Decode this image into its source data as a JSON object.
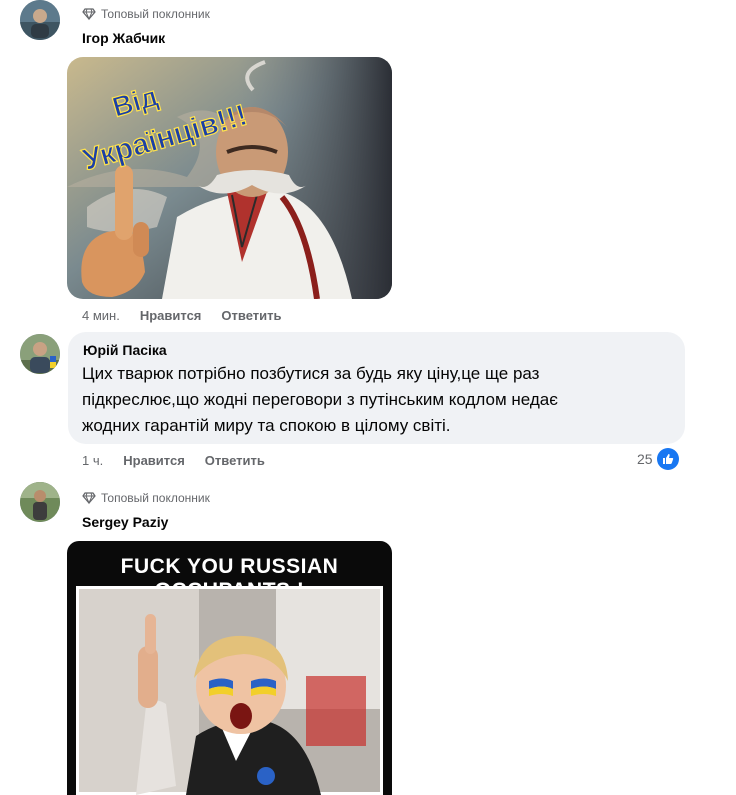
{
  "comments": [
    {
      "badge": "Топовый поклонник",
      "author": "Ігор Жабчик",
      "meme_text": "Від Українців!!!",
      "time": "4 мин.",
      "like_label": "Нравится",
      "reply_label": "Ответить"
    },
    {
      "author": "Юрій Пасіка",
      "text_lines": [
        "Цих тварюк потрібно позбутися за будь яку ціну,це ще раз",
        "підкреслює,що жодні переговори з путінським кодлом недає",
        "жодних гарантій миру та спокою в цілому світі."
      ],
      "time": "1 ч.",
      "like_label": "Нравится",
      "reply_label": "Ответить",
      "reaction_count": "25",
      "reaction_icon": "like-icon"
    },
    {
      "badge": "Топовый поклонник",
      "author": "Sergey Paziy",
      "meme_text": "FUCK YOU RUSSIAN OCCUPANTS !"
    }
  ],
  "colors": {
    "meta_gray": "#65676b",
    "bubble_bg": "#f0f2f5",
    "like_blue": "#1877f2"
  }
}
